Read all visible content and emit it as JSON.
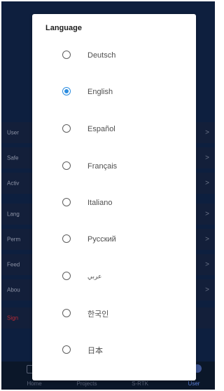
{
  "background_menu": {
    "rows": [
      {
        "label": "User"
      },
      {
        "label": "Safe"
      },
      {
        "label": "Activ"
      },
      {
        "label": "Lang"
      },
      {
        "label": "Perm"
      },
      {
        "label": "Feed"
      },
      {
        "label": "Abou"
      },
      {
        "label": "Sign"
      }
    ],
    "chevron": ">"
  },
  "bottom_nav": {
    "items": [
      {
        "label": "Home"
      },
      {
        "label": "Projects"
      },
      {
        "label": "S-RTK"
      },
      {
        "label": "User"
      }
    ]
  },
  "dialog": {
    "title": "Language",
    "options": [
      {
        "label": "Deutsch",
        "selected": false
      },
      {
        "label": "English",
        "selected": true
      },
      {
        "label": "Español",
        "selected": false
      },
      {
        "label": "Français",
        "selected": false
      },
      {
        "label": "Italiano",
        "selected": false
      },
      {
        "label": "Русский",
        "selected": false
      },
      {
        "label": "عربي",
        "selected": false
      },
      {
        "label": "한국인",
        "selected": false
      },
      {
        "label": "日本",
        "selected": false
      }
    ]
  },
  "colors": {
    "accent": "#2c8de0",
    "background_dim": "#0d1f3f",
    "danger": "#b62a36"
  }
}
